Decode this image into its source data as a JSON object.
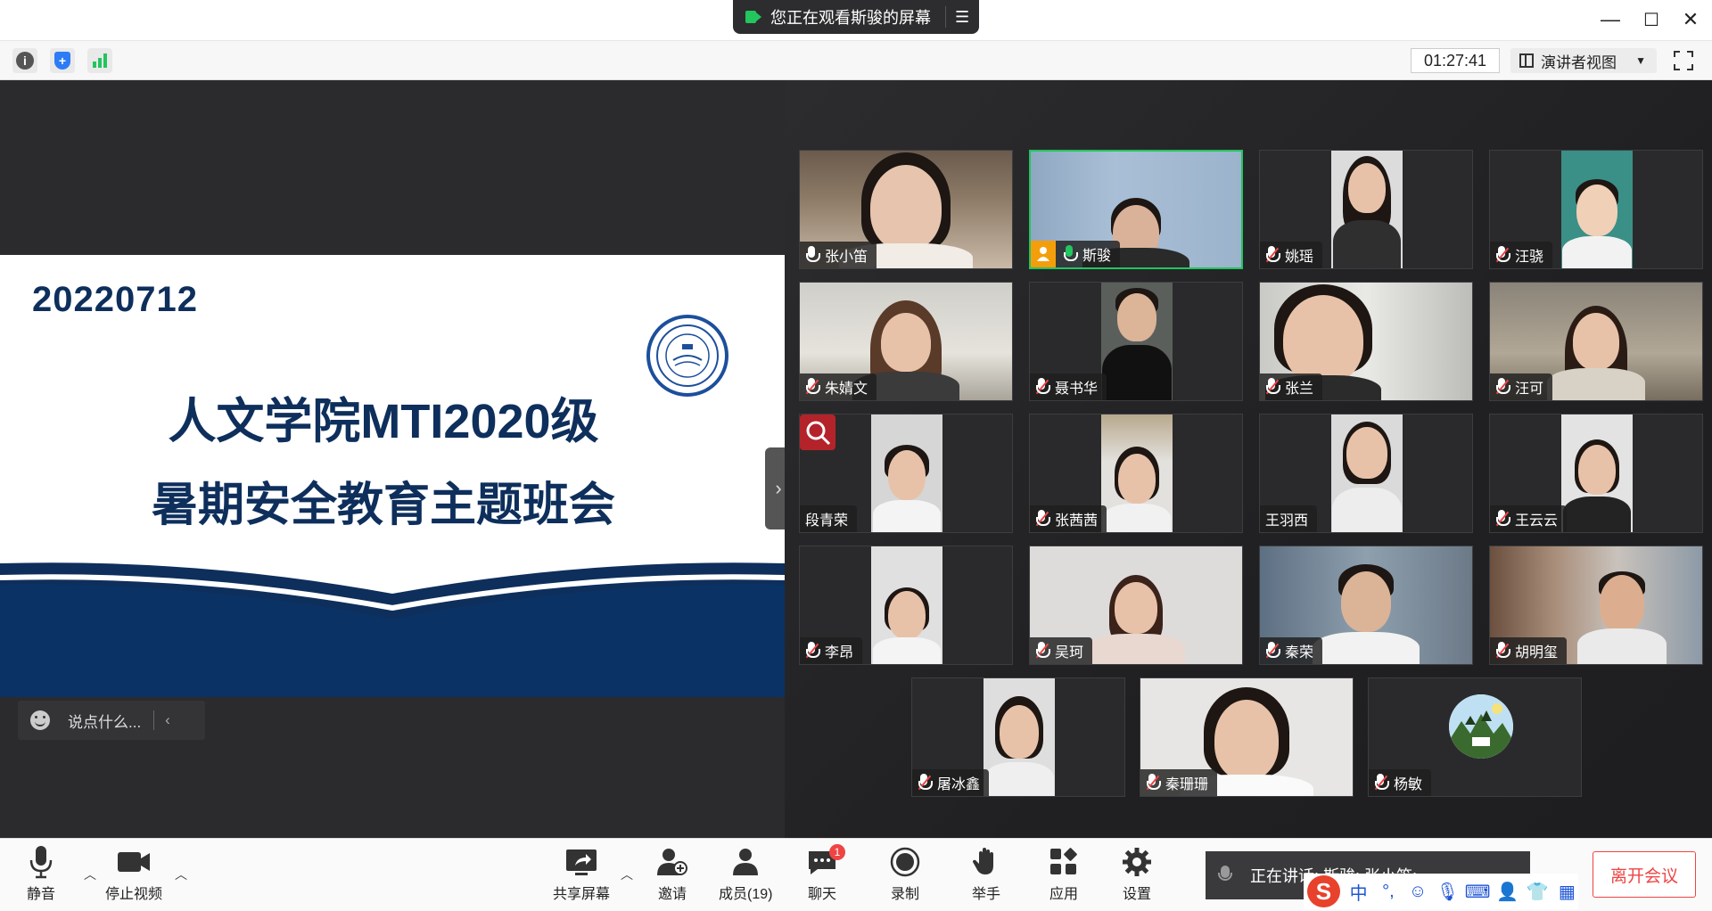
{
  "titlebar": {
    "share_notice": "您正在观看斯骏的屏幕",
    "menu_icon": "list-icon",
    "minimize_label": "—",
    "maximize_label": "☐",
    "close_label": "✕"
  },
  "toolbar": {
    "meeting_timer": "01:27:41",
    "view_mode": "演讲者视图",
    "info_label": "i",
    "security_label": "+"
  },
  "slide": {
    "date": "20220712",
    "title_line1": "人文学院MTI2020级",
    "title_line2": "暑期安全教育主题班会"
  },
  "chat": {
    "placeholder": "说点什么..."
  },
  "participants": [
    {
      "name": "张小笛",
      "mic": "on"
    },
    {
      "name": "斯骏",
      "mic": "live",
      "host": true,
      "active_speaker": true
    },
    {
      "name": "姚瑶",
      "mic": "muted"
    },
    {
      "name": "汪骁",
      "mic": "muted"
    },
    {
      "name": "朱婧文",
      "mic": "muted"
    },
    {
      "name": "聂书华",
      "mic": "muted"
    },
    {
      "name": "张兰",
      "mic": "muted"
    },
    {
      "name": "汪可",
      "mic": "muted"
    },
    {
      "name": "段青荣",
      "mic": "none"
    },
    {
      "name": "张茜茜",
      "mic": "muted"
    },
    {
      "name": "王羽西",
      "mic": "none"
    },
    {
      "name": "王云云",
      "mic": "muted"
    },
    {
      "name": "李昂",
      "mic": "muted"
    },
    {
      "name": "吴珂",
      "mic": "muted"
    },
    {
      "name": "秦荣",
      "mic": "muted"
    },
    {
      "name": "胡明玺",
      "mic": "muted"
    },
    {
      "name": "屠冰鑫",
      "mic": "muted"
    },
    {
      "name": "秦珊珊",
      "mic": "muted"
    },
    {
      "name": "杨敏",
      "mic": "muted"
    }
  ],
  "bottombar": {
    "mute": "静音",
    "stop_video": "停止视频",
    "share_screen": "共享屏幕",
    "invite": "邀请",
    "members": "成员(19)",
    "chat": "聊天",
    "chat_badge": "1",
    "record": "录制",
    "raise_hand": "举手",
    "apps": "应用",
    "settings": "设置",
    "speaking_now": "正在讲话: 斯骏; 张小笛;",
    "leave": "离开会议"
  },
  "ime": {
    "logo": "S",
    "mode": "中",
    "punct": "°,"
  },
  "colors": {
    "accent_green": "#22c55e",
    "navy": "#0e2f5c",
    "leave_red": "#ef4444"
  }
}
